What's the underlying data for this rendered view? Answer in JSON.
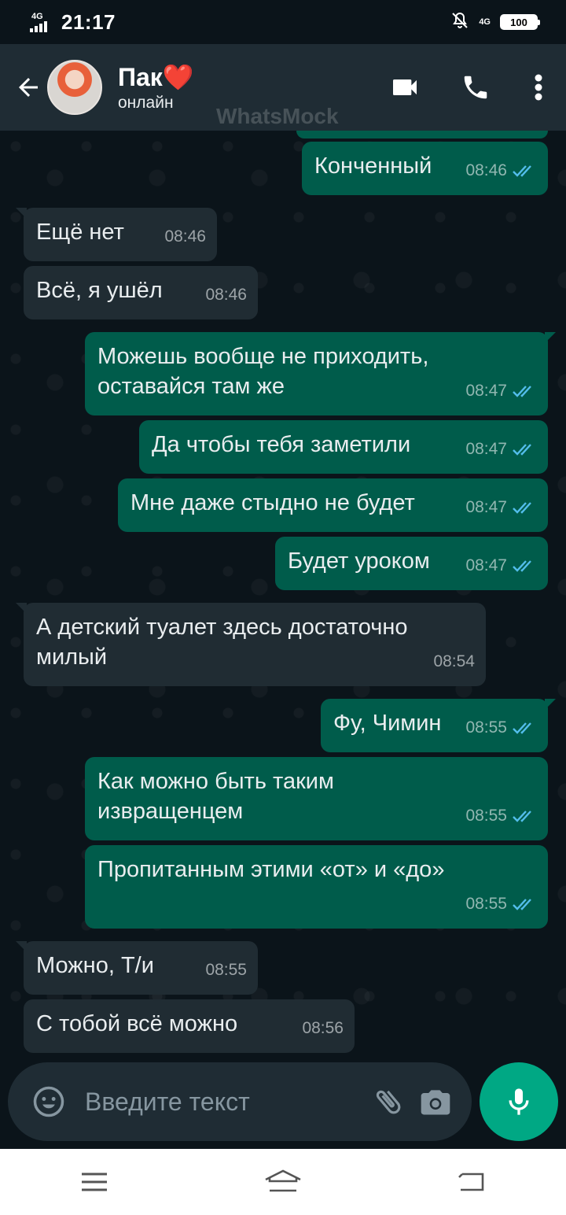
{
  "status_bar": {
    "network_left": "4G",
    "time": "21:17",
    "network_right": "4G",
    "battery": "100"
  },
  "header": {
    "contact_name": "Пак",
    "contact_emoji": "❤️",
    "contact_status": "онлайн",
    "watermark": "WhatsMock",
    "icons": [
      "back-arrow-icon",
      "video-call-icon",
      "phone-icon",
      "more-vertical-icon"
    ]
  },
  "messages": [
    {
      "direction": "out",
      "text": "Конченный",
      "time": "08:46",
      "read": true
    },
    {
      "direction": "in",
      "text": "Ещё нет",
      "time": "08:46"
    },
    {
      "direction": "in",
      "text": "Всё, я ушёл",
      "time": "08:46"
    },
    {
      "direction": "out",
      "text": "Можешь вообще не приходить,\nоставайся там же",
      "time": "08:47",
      "read": true
    },
    {
      "direction": "out",
      "text": "Да чтобы тебя заметили",
      "time": "08:47",
      "read": true
    },
    {
      "direction": "out",
      "text": "Мне даже стыдно не будет",
      "time": "08:47",
      "read": true
    },
    {
      "direction": "out",
      "text": "Будет уроком",
      "time": "08:47",
      "read": true
    },
    {
      "direction": "in",
      "text": "А детский туалет здесь достаточно\nмилый",
      "time": "08:54"
    },
    {
      "direction": "out",
      "text": "Фу, Чимин",
      "time": "08:55",
      "read": true
    },
    {
      "direction": "out",
      "text": "Как можно быть таким\nизвращенцем",
      "time": "08:55",
      "read": true
    },
    {
      "direction": "out",
      "text": "Пропитанным этими «от» и «до»",
      "time": "08:55",
      "read": true
    },
    {
      "direction": "in",
      "text": "Можно, Т/и",
      "time": "08:55"
    },
    {
      "direction": "in",
      "text": "С тобой всё можно",
      "time": "08:56"
    }
  ],
  "composer": {
    "placeholder": "Введите текст",
    "icons": [
      "emoji-icon",
      "attach-icon",
      "camera-icon",
      "mic-icon"
    ]
  },
  "colors": {
    "background": "#0b141a",
    "header": "#1f2c34",
    "outgoing_bubble": "#005c4b",
    "incoming_bubble": "#202c33",
    "read_ticks": "#53bdeb",
    "accent": "#00a884"
  }
}
